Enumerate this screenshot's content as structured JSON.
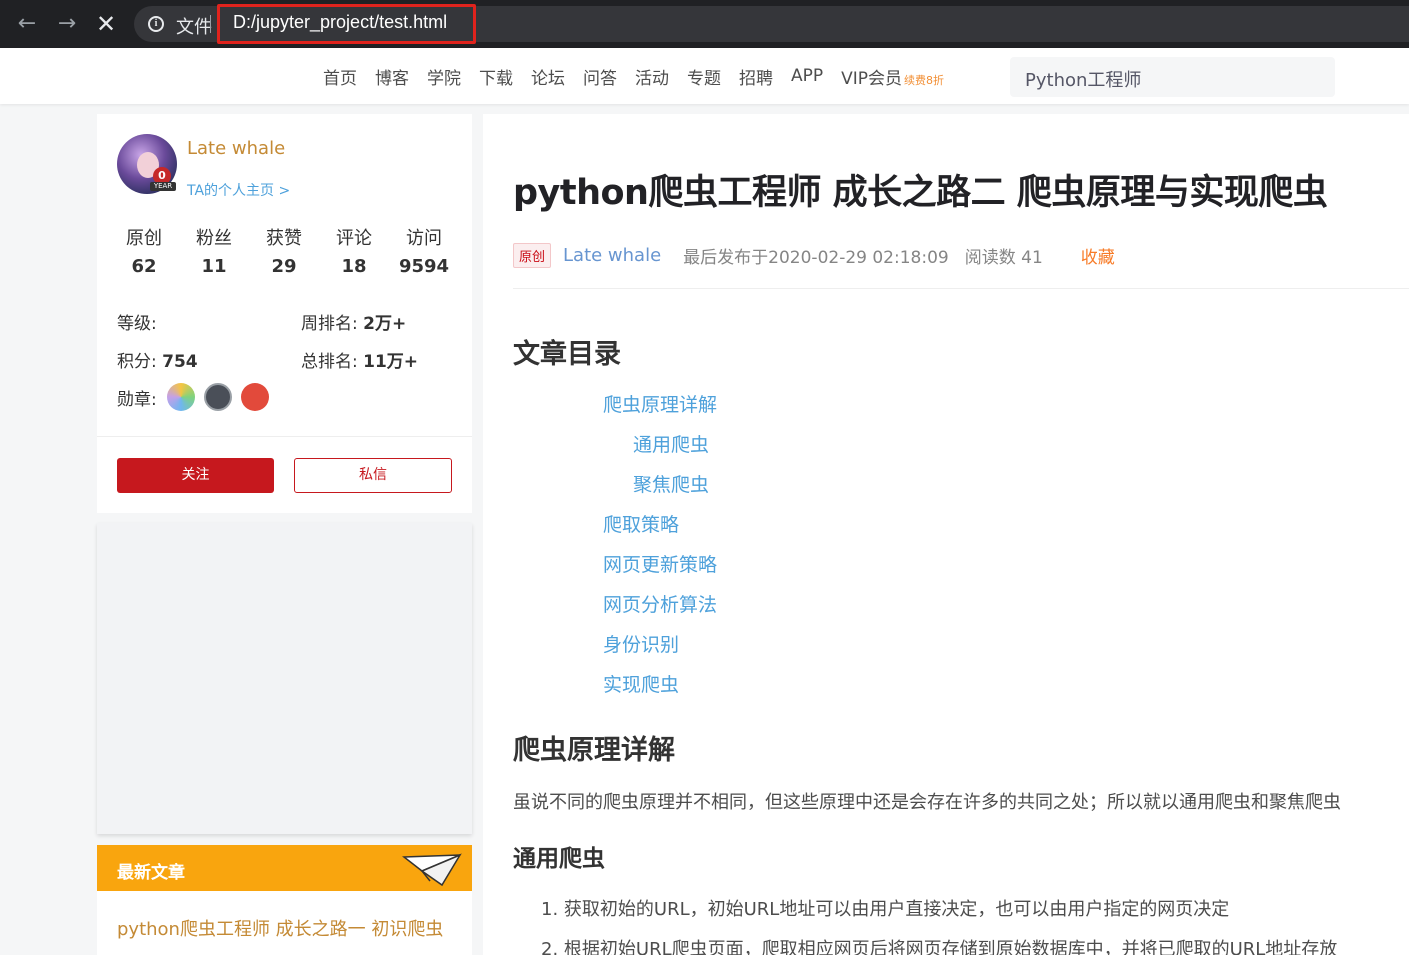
{
  "browser": {
    "scheme_label": "文件",
    "url": "D:/jupyter_project/test.html"
  },
  "site_nav": {
    "links": [
      "首页",
      "博客",
      "学院",
      "下载",
      "论坛",
      "问答",
      "活动",
      "专题",
      "招聘",
      "APP",
      "VIP会员"
    ],
    "vip_badge": "续费8折",
    "search_value": "Python工程师"
  },
  "profile": {
    "name": "Late whale",
    "home_link": "TA的个人主页 >",
    "year_badge_num": "0",
    "year_badge_label": "YEAR",
    "stats": [
      {
        "label": "原创",
        "value": "62"
      },
      {
        "label": "粉丝",
        "value": "11"
      },
      {
        "label": "获赞",
        "value": "29"
      },
      {
        "label": "评论",
        "value": "18"
      },
      {
        "label": "访问",
        "value": "9594"
      }
    ],
    "level_label": "等级:",
    "week_rank_label": "周排名:",
    "week_rank_value": "2万+",
    "points_label": "积分:",
    "points_value": "754",
    "total_rank_label": "总排名:",
    "total_rank_value": "11万+",
    "medals_label": "勋章:",
    "follow_label": "关注",
    "message_label": "私信"
  },
  "recent": {
    "title": "最新文章",
    "items": [
      "python爬虫工程师 成长之路一 初识爬虫"
    ]
  },
  "article": {
    "title": "python爬虫工程师 成长之路二 爬虫原理与实现爬虫",
    "orig_tag": "原创",
    "author": "Late whale",
    "date": "最后发布于2020-02-29 02:18:09",
    "reads": "阅读数 41",
    "favorite": "收藏",
    "toc_title": "文章目录",
    "toc": [
      "爬虫原理详解",
      "通用爬虫",
      "聚焦爬虫",
      "爬取策略",
      "网页更新策略",
      "网页分析算法",
      "身份识别",
      "实现爬虫"
    ],
    "section1_title": "爬虫原理详解",
    "section1_text": "虽说不同的爬虫原理并不相同，但这些原理中还是会存在许多的共同之处；所以就以通用爬虫和聚焦爬虫",
    "section2_title": "通用爬虫",
    "list": [
      "1. 获取初始的URL，初始URL地址可以由用户直接决定，也可以由用户指定的网页决定",
      "2. 根据初始URL爬虫页面，爬取相应网页后将网页存储到原始数据库中，并将已爬取的URL地址存放"
    ]
  }
}
